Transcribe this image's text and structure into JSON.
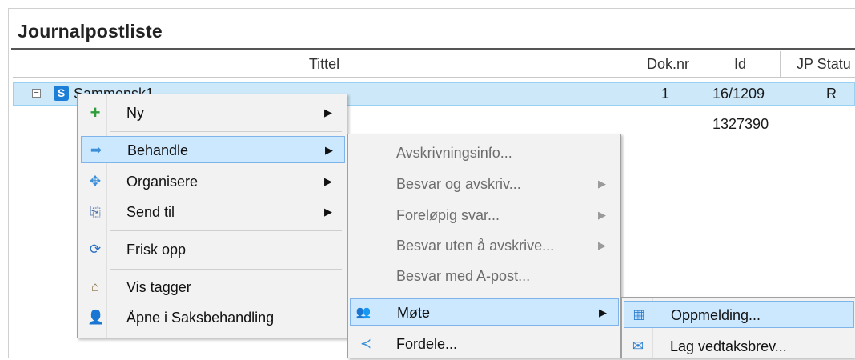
{
  "panel": {
    "title": "Journalpostliste"
  },
  "columns": {
    "tittel": "Tittel",
    "doknr": "Dok.nr",
    "id": "Id",
    "jpstatus": "JP Statu"
  },
  "rows": [
    {
      "tittel": "Sammensk1",
      "doknr": "1",
      "id": "16/1209",
      "status": "R"
    },
    {
      "id": "1327390"
    }
  ],
  "context_menu": {
    "items": [
      {
        "label": "Ny",
        "icon": "plus-icon"
      },
      {
        "label": "Behandle",
        "icon": "arrow-right-icon"
      },
      {
        "label": "Organisere",
        "icon": "move-icon"
      },
      {
        "label": "Send til",
        "icon": "send-icon"
      },
      {
        "label": "Frisk opp",
        "icon": "refresh-icon"
      },
      {
        "label": "Vis tagger",
        "icon": "tag-house-icon"
      },
      {
        "label": "Åpne i Saksbehandling",
        "icon": "person-icon"
      }
    ]
  },
  "behandle_menu": {
    "items": [
      {
        "label": "Avskrivningsinfo..."
      },
      {
        "label": "Besvar og avskriv..."
      },
      {
        "label": "Foreløpig svar..."
      },
      {
        "label": "Besvar uten å avskrive..."
      },
      {
        "label": "Besvar med A-post..."
      },
      {
        "label": "Møte",
        "icon": "people-icon"
      },
      {
        "label": "Fordele...",
        "icon": "share-icon"
      }
    ]
  },
  "mote_menu": {
    "items": [
      {
        "label": "Oppmelding...",
        "icon": "calendar-add-icon"
      },
      {
        "label": "Lag vedtaksbrev...",
        "icon": "letter-arrow-icon"
      }
    ]
  },
  "arrow_glyph": "▶",
  "colors": {
    "highlight": "#cce8ff",
    "highlight_border": "#7eb4ea",
    "row_selected": "#cde8f8",
    "disabled_text": "#6d6d6d"
  }
}
